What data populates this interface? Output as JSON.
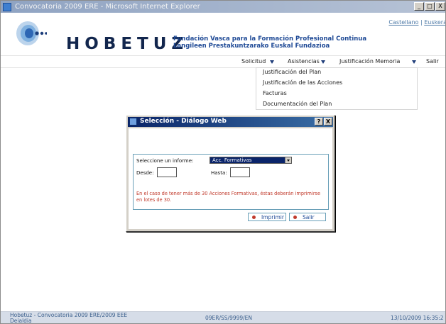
{
  "window": {
    "title": "Convocatoria 2009 ERE - Microsoft Internet Explorer",
    "minimize": "_",
    "maximize": "□",
    "close": "X"
  },
  "header": {
    "lang_castellano": "Castellano",
    "lang_separator": " | ",
    "lang_euskera": "Euskera",
    "brand": "HOBETUZ",
    "subtitle_es": "Fundación Vasca para la Formación Profesional Continua",
    "subtitle_eu": "Langileen Prestakuntzarako Euskal Fundazioa"
  },
  "menu": {
    "items": [
      {
        "label": "Solicitud"
      },
      {
        "label": "Asistencias"
      },
      {
        "label": "Justificación Memoria"
      },
      {
        "label": "Salir"
      }
    ]
  },
  "dropdown": {
    "items": [
      {
        "label": "Justificación del Plan"
      },
      {
        "label": "Justificación de las Acciones"
      },
      {
        "label": "Facturas"
      },
      {
        "label": "Documentación del Plan"
      }
    ]
  },
  "dialog": {
    "title": "Selección - Diálogo Web",
    "help_button": "?",
    "close_button": "X",
    "select_label": "Seleccione un informe:",
    "select_value": "Acc. Formativas",
    "desde_label": "Desde:",
    "desde_value": "",
    "hasta_label": "Hasta:",
    "hasta_value": "",
    "warning": "En el caso de tener más de 30 Acciones Formativas, éstas deberán imprimirse en lotes de 30.",
    "print_button": "Imprimir",
    "exit_button": "Salir"
  },
  "status": {
    "left_line1": "Hobetuz - Convocatoria 2009 ERE/2009 EEE",
    "left_line2": "Deialdia",
    "center": "09ER/SS/9999/EN",
    "right": "13/10/2009 16:35:2"
  },
  "colors": {
    "brand_navy": "#12264d",
    "subtitle_blue": "#1f4a96",
    "warning_red": "#c0392b",
    "selection_blue": "#0a246a"
  }
}
